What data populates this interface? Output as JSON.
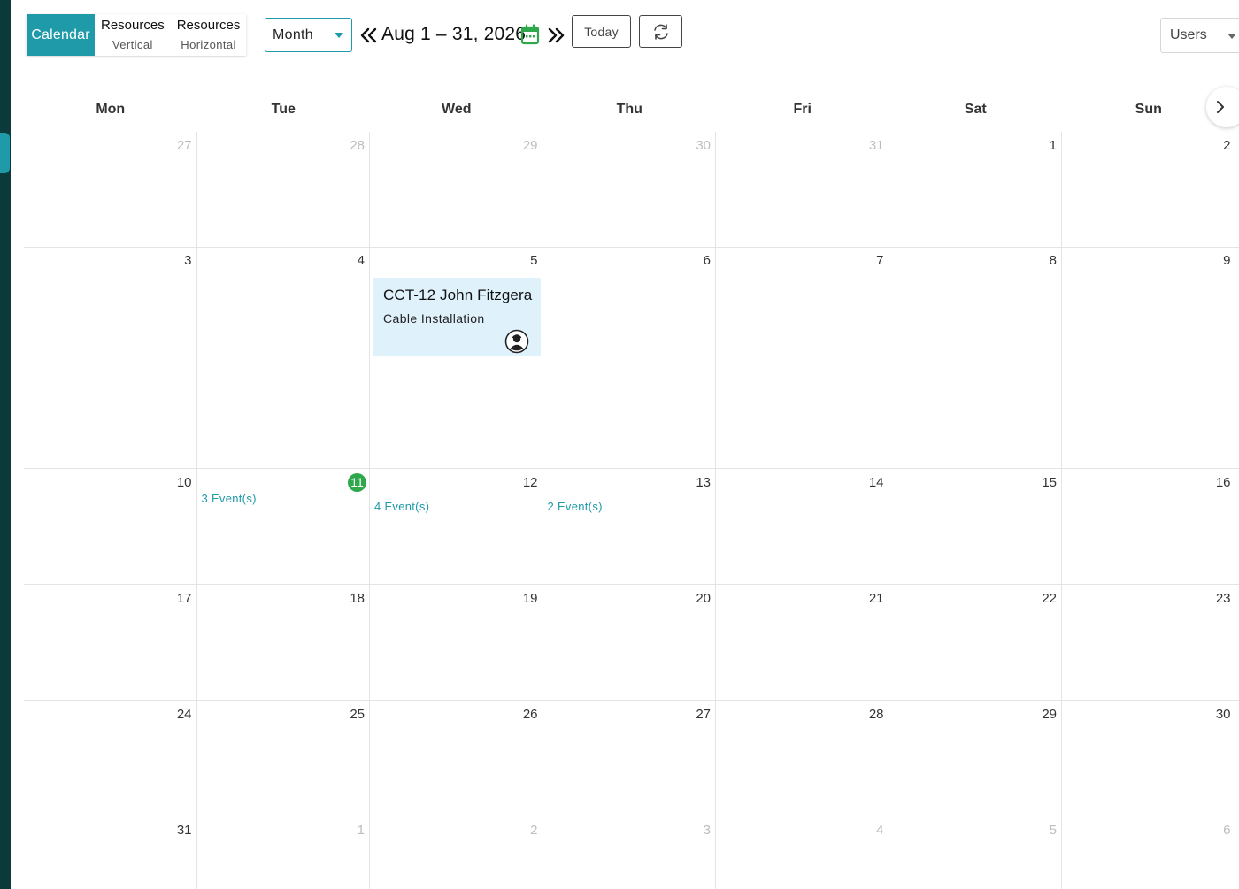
{
  "toolbar": {
    "tabs": [
      {
        "label": "Calendar",
        "active": true
      },
      {
        "label": "Resources",
        "sub": "Vertical"
      },
      {
        "label": "Resources",
        "sub": "Horizontal"
      }
    ],
    "view_select": "Month",
    "date_range": "Aug 1 – 31, 2026",
    "today_label": "Today",
    "users_select": "Users"
  },
  "calendar": {
    "weekdays": [
      "Mon",
      "Tue",
      "Wed",
      "Thu",
      "Fri",
      "Sat",
      "Sun"
    ],
    "weeks": [
      [
        {
          "n": "27",
          "muted": true
        },
        {
          "n": "28",
          "muted": true
        },
        {
          "n": "29",
          "muted": true
        },
        {
          "n": "30",
          "muted": true
        },
        {
          "n": "31",
          "muted": true
        },
        {
          "n": "1"
        },
        {
          "n": "2"
        }
      ],
      [
        {
          "n": "3"
        },
        {
          "n": "4"
        },
        {
          "n": "5"
        },
        {
          "n": "6"
        },
        {
          "n": "7"
        },
        {
          "n": "8"
        },
        {
          "n": "9"
        }
      ],
      [
        {
          "n": "10"
        },
        {
          "n": "11",
          "today": true,
          "more": "3 Event(s)"
        },
        {
          "n": "12",
          "more": "4 Event(s)"
        },
        {
          "n": "13",
          "more": "2 Event(s)"
        },
        {
          "n": "14"
        },
        {
          "n": "15"
        },
        {
          "n": "16"
        }
      ],
      [
        {
          "n": "17"
        },
        {
          "n": "18"
        },
        {
          "n": "19"
        },
        {
          "n": "20"
        },
        {
          "n": "21"
        },
        {
          "n": "22"
        },
        {
          "n": "23"
        }
      ],
      [
        {
          "n": "24"
        },
        {
          "n": "25"
        },
        {
          "n": "26"
        },
        {
          "n": "27"
        },
        {
          "n": "28"
        },
        {
          "n": "29"
        },
        {
          "n": "30"
        }
      ],
      [
        {
          "n": "31"
        },
        {
          "n": "1",
          "muted": true
        },
        {
          "n": "2",
          "muted": true
        },
        {
          "n": "3",
          "muted": true
        },
        {
          "n": "4",
          "muted": true
        },
        {
          "n": "5",
          "muted": true
        },
        {
          "n": "6",
          "muted": true
        }
      ]
    ],
    "event": {
      "title": "CCT-12 John Fitzgera",
      "subtitle": "Cable Installation",
      "avatar_icon": "user-avatar-icon"
    }
  },
  "colors": {
    "accent": "#1f9aa9",
    "today": "#2ea84a",
    "event_bg": "#dff1fb",
    "sidebar": "#0c3a3a"
  }
}
